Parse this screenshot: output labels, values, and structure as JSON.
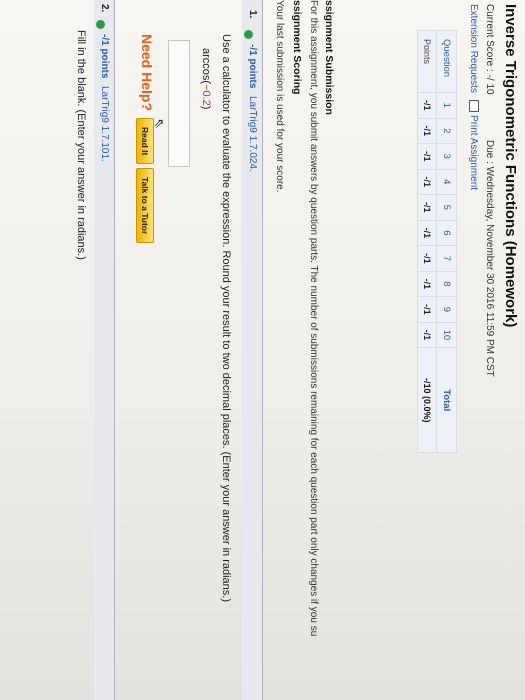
{
  "page": {
    "title": "Inverse Trigonometric Functions (Homework)",
    "current_score": "Current Score : -/ 10",
    "due": "Due : Wednesday, November 30 2016 11:59 PM CST",
    "extension_requests": "Extension Requests",
    "print_assignment": "Print Assignment"
  },
  "score_table": {
    "question_label": "Question",
    "points_label": "Points",
    "questions": [
      "1",
      "2",
      "3",
      "4",
      "5",
      "6",
      "7",
      "8",
      "9",
      "10"
    ],
    "points": [
      "-/1",
      "-/1",
      "-/1",
      "-/1",
      "-/1",
      "-/1",
      "-/1",
      "-/1",
      "-/1",
      "-/1"
    ],
    "total_label": "Total",
    "total_value": "-/10 (0.0%)"
  },
  "assignment": {
    "submission_heading": "ssignment Submission",
    "submission_text": "For this assignment, you submit answers by question parts. The number of submissions remaining for each question part only changes if you su",
    "scoring_heading": "ssignment Scoring",
    "scoring_text": "Your last submission is used for your score."
  },
  "question1": {
    "number": "1.",
    "points": "-/1 points",
    "code": "LarTrig9 1.7.024.",
    "prompt": "Use a calculator to evaluate the expression. Round your result to two decimal places. (Enter your answer in radians.)",
    "expr_prefix": "arccos(",
    "expr_value": "−0.2",
    "expr_suffix": ")",
    "need_help": "Need Help?",
    "read_it": "Read It",
    "talk_tutor": "Talk to a Tutor"
  },
  "question2": {
    "number": "2.",
    "points": "-/1 points",
    "code": "LarTrig9 1.7.101.",
    "prompt": "Fill in the blank. (Enter your answer in radians.)"
  },
  "colors": {
    "accent": "#2a5db0",
    "need_help": "#e0621b",
    "button": "#f4b400",
    "badge": "#2f9a4b"
  }
}
